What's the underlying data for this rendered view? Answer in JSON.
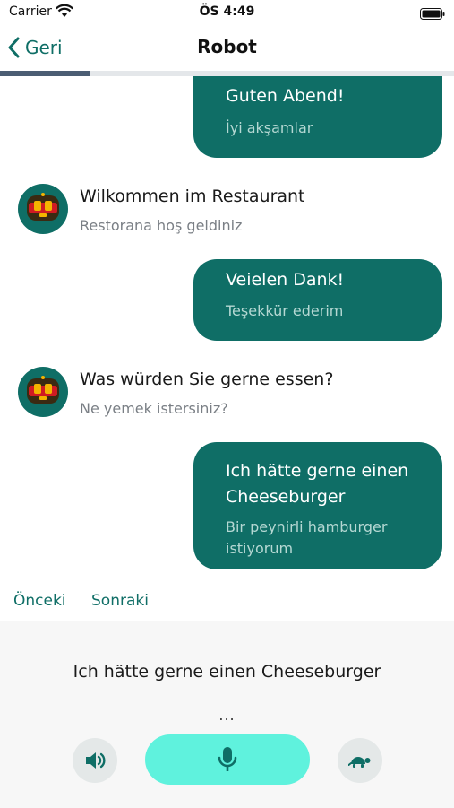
{
  "status_bar": {
    "carrier": "Carrier",
    "time": "ÖS 4:49",
    "wifi_icon": "wifi-icon",
    "battery_icon": "battery-icon"
  },
  "nav": {
    "back_label": "Geri",
    "title": "Robot"
  },
  "progress": {
    "value_fraction": 0.2
  },
  "messages": [
    {
      "role": "user",
      "text": "Guten Abend!",
      "translation": "İyi akşamlar"
    },
    {
      "role": "bot",
      "text": "Wilkommen im Restaurant",
      "translation": "Restorana hoş geldiniz"
    },
    {
      "role": "user",
      "text": "Veielen Dank!",
      "translation": "Teşekkür ederim"
    },
    {
      "role": "bot",
      "text": "Was würden Sie gerne essen?",
      "translation": "Ne yemek istersiniz?"
    },
    {
      "role": "user",
      "text": "Ich hätte gerne einen Cheeseburger",
      "translation": "Bir peynirli hamburger istiyorum"
    }
  ],
  "controls": {
    "previous_label": "Önceki",
    "next_label": "Sonraki"
  },
  "bottom": {
    "transcript": "Ich hätte gerne einen Cheeseburger",
    "status": "...",
    "speaker_icon": "speaker-icon",
    "mic_icon": "microphone-icon",
    "slow_icon": "turtle-icon"
  },
  "colors": {
    "accent": "#0f6e66",
    "mic_button": "#5ff2dd",
    "progress": "#4b5d73"
  }
}
